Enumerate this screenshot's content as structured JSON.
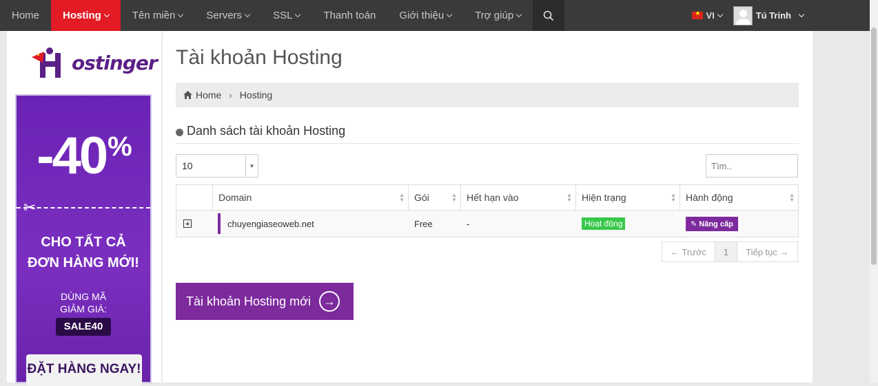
{
  "nav": {
    "items": [
      {
        "label": "Home",
        "active": false,
        "dropdown": false
      },
      {
        "label": "Hosting",
        "active": true,
        "dropdown": true
      },
      {
        "label": "Tên miền",
        "active": false,
        "dropdown": true
      },
      {
        "label": "Servers",
        "active": false,
        "dropdown": true
      },
      {
        "label": "SSL",
        "active": false,
        "dropdown": true
      },
      {
        "label": "Thanh toán",
        "active": false,
        "dropdown": false
      },
      {
        "label": "Giới thiệu",
        "active": false,
        "dropdown": true
      },
      {
        "label": "Trợ giúp",
        "active": false,
        "dropdown": true
      }
    ],
    "search_icon": "search-icon",
    "language": "VI",
    "user_name": "Tú Trinh"
  },
  "colors": {
    "nav_bg": "#3a3a3a",
    "nav_active": "#e21b25",
    "brand_purple": "#7d2a9d",
    "status_green": "#37c84a"
  },
  "sidebar": {
    "logo_text": "ostinger",
    "promo": {
      "discount": "-40",
      "percent": "%",
      "line1": "CHO TẤT CẢ",
      "line2": "ĐƠN HÀNG MỚI!",
      "use_code_1": "DÙNG MÃ",
      "use_code_2": "GIẢM GIÁ:",
      "code": "SALE40",
      "cta": "ĐẶT HÀNG NGAY!"
    }
  },
  "main": {
    "title": "Tài khoản Hosting",
    "breadcrumb": {
      "home": "Home",
      "current": "Hosting"
    },
    "section_title": "Danh sách tài khoản Hosting",
    "page_length": "10",
    "search_placeholder": "Tìm..",
    "table": {
      "columns": [
        "Domain",
        "Gói",
        "Hết hạn vào",
        "Hiện trạng",
        "Hành động"
      ],
      "rows": [
        {
          "domain": "chuyengiaseoweb.net",
          "plan": "Free",
          "expires": "-",
          "status": "Hoạt động",
          "action": "Nâng cấp"
        }
      ]
    },
    "pagination": {
      "prev": "← Trước",
      "page": "1",
      "next": "Tiếp tục →"
    },
    "new_account_button": "Tài khoản Hosting mới"
  }
}
